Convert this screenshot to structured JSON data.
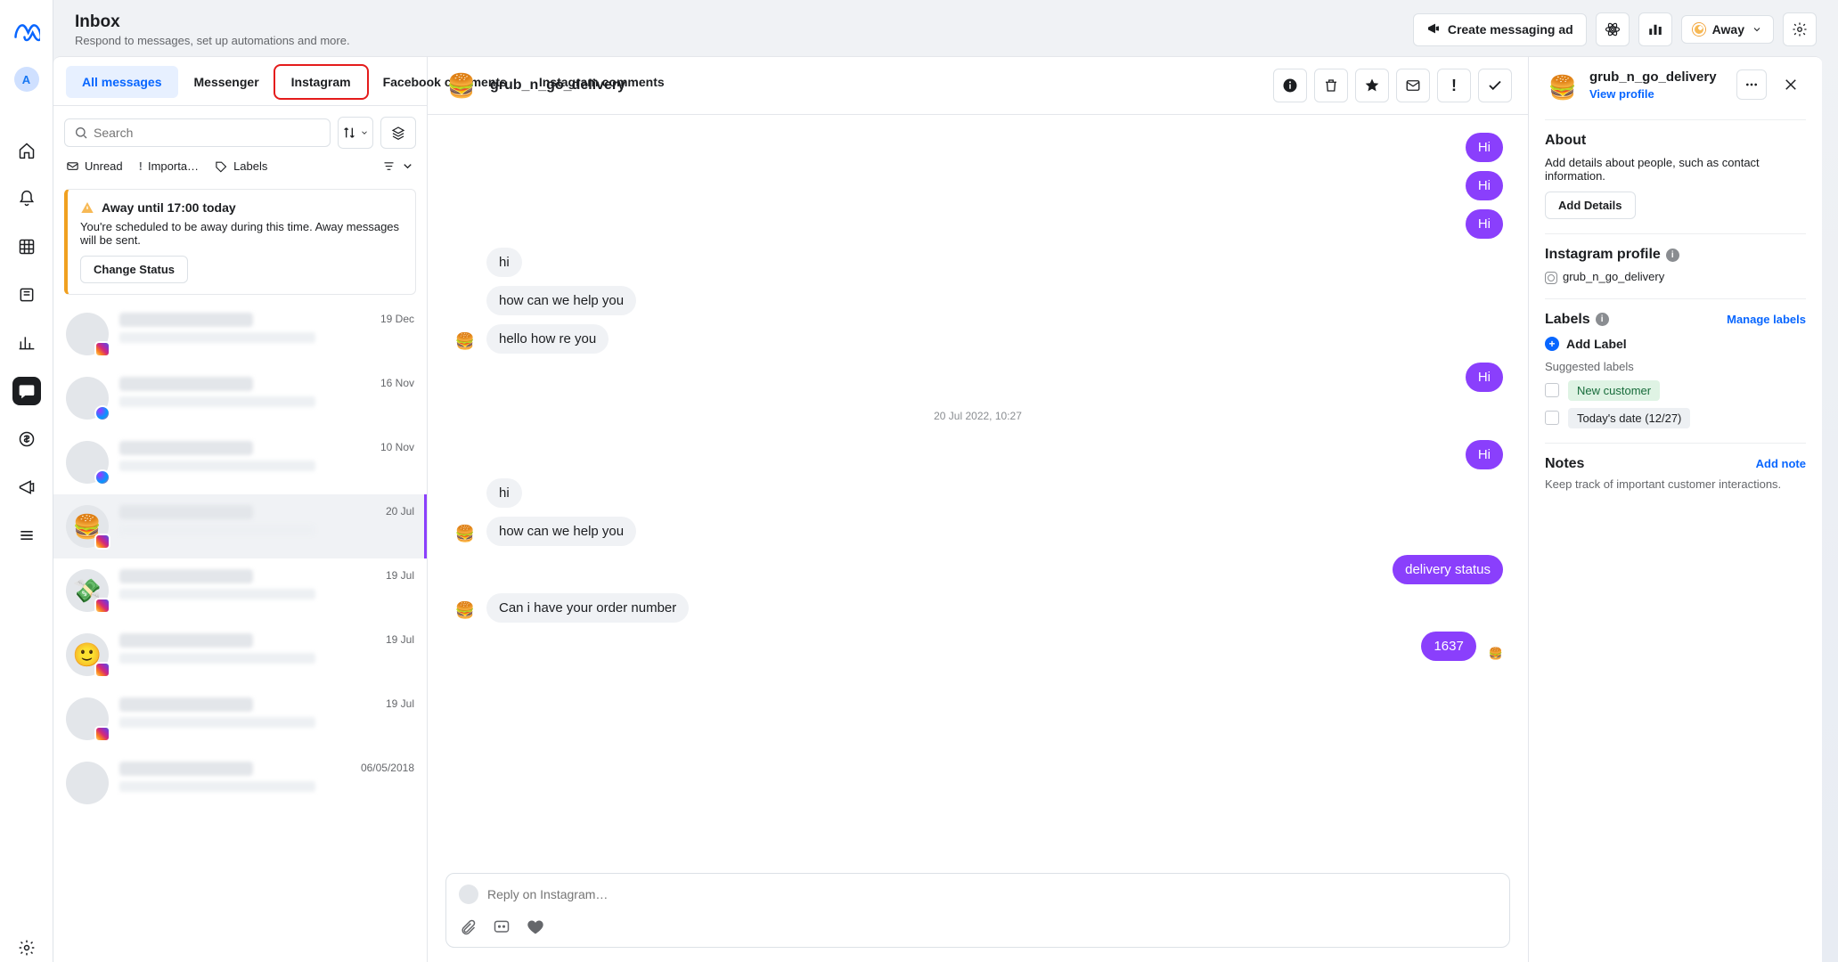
{
  "header": {
    "title": "Inbox",
    "subtitle": "Respond to messages, set up automations and more.",
    "create_ad": "Create messaging ad",
    "status_label": "Away"
  },
  "tabs": {
    "all": "All messages",
    "messenger": "Messenger",
    "instagram": "Instagram",
    "fb_comments": "Facebook comments",
    "ig_comments": "Instagram comments"
  },
  "search": {
    "placeholder": "Search"
  },
  "filters": {
    "unread": "Unread",
    "important": "Importa…",
    "labels": "Labels"
  },
  "away_alert": {
    "title": "Away until 17:00 today",
    "desc": "You're scheduled to be away during this time. Away messages will be sent.",
    "button": "Change Status"
  },
  "conversations": [
    {
      "date": "19 Dec",
      "badge": "ig"
    },
    {
      "date": "16 Nov",
      "badge": "msg"
    },
    {
      "date": "10 Nov",
      "badge": "msg"
    },
    {
      "date": "20 Jul",
      "badge": "ig",
      "selected": true,
      "emoji": "🍔"
    },
    {
      "date": "19 Jul",
      "badge": "ig",
      "emoji": "💸"
    },
    {
      "date": "19 Jul",
      "badge": "ig",
      "emoji": "🙂"
    },
    {
      "date": "19 Jul",
      "badge": "ig"
    },
    {
      "date": "06/05/2018",
      "badge": ""
    }
  ],
  "chat": {
    "title": "grub_n_go_delivery",
    "timestamp": "20 Jul 2022, 10:27",
    "messages": [
      {
        "side": "out",
        "text": "Hi"
      },
      {
        "side": "out",
        "text": "Hi"
      },
      {
        "side": "out",
        "text": "Hi"
      },
      {
        "side": "in",
        "text": "hi"
      },
      {
        "side": "in",
        "text": "how can we help you"
      },
      {
        "side": "in",
        "text": "hello how re you",
        "avatar": true
      },
      {
        "side": "out",
        "text": "Hi"
      },
      {
        "side": "ts"
      },
      {
        "side": "out",
        "text": "Hi"
      },
      {
        "side": "in",
        "text": "hi"
      },
      {
        "side": "in",
        "text": "how can we help you",
        "avatar": true
      },
      {
        "side": "out",
        "text": "delivery status"
      },
      {
        "side": "in",
        "text": "Can i have your order number",
        "avatar": true
      },
      {
        "side": "out",
        "text": "1637",
        "react": "🍔"
      }
    ],
    "compose_placeholder": "Reply on Instagram…"
  },
  "aside": {
    "name": "grub_n_go_delivery",
    "view_profile": "View profile",
    "about_h": "About",
    "about_p": "Add details about people, such as contact information.",
    "add_details": "Add Details",
    "ig_profile_h": "Instagram profile",
    "ig_handle": "grub_n_go_delivery",
    "labels_h": "Labels",
    "manage_labels": "Manage labels",
    "add_label": "Add Label",
    "suggested_h": "Suggested labels",
    "chip_new": "New customer",
    "chip_today": "Today's date (12/27)",
    "notes_h": "Notes",
    "add_note": "Add note",
    "notes_p": "Keep track of important customer interactions."
  },
  "rail": {
    "avatar_letter": "A"
  }
}
